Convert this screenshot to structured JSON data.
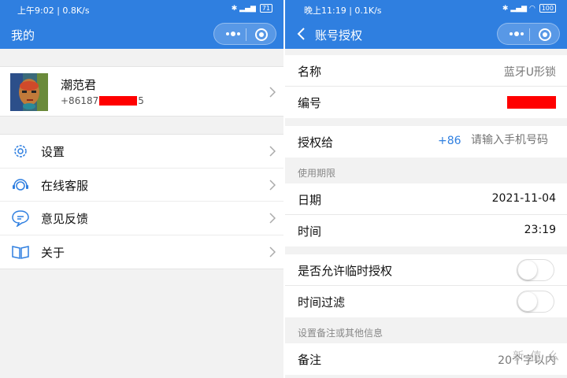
{
  "left": {
    "status": {
      "left": "上午9:02 | 0.8K/s",
      "right": "4G 4G 71"
    },
    "nav": {
      "title": "我的"
    },
    "profile": {
      "name": "潮范君",
      "phone_prefix": "+86187",
      "phone_suffix": "5"
    },
    "menu": [
      {
        "label": "设置",
        "icon": "gear-icon"
      },
      {
        "label": "在线客服",
        "icon": "headset-icon"
      },
      {
        "label": "意见反馈",
        "icon": "chat-icon"
      },
      {
        "label": "关于",
        "icon": "book-icon"
      }
    ]
  },
  "right": {
    "status": {
      "left": "晚上11:19 | 0.1K/s",
      "right": "100"
    },
    "nav": {
      "title": "账号授权"
    },
    "name_row": {
      "label": "名称",
      "value": "蓝牙U形锁"
    },
    "id_row": {
      "label": "编号"
    },
    "auth_row": {
      "label": "授权给",
      "country_code": "+86",
      "placeholder": "请输入手机号码"
    },
    "section_period": "使用期限",
    "date_row": {
      "label": "日期",
      "value": "2021-11-04"
    },
    "time_row": {
      "label": "时间",
      "value": "23:19"
    },
    "temp_auth": {
      "label": "是否允许临时授权",
      "on": false
    },
    "time_filter": {
      "label": "时间过滤",
      "on": false
    },
    "section_note": "设置备注或其他信息",
    "note_row": {
      "label": "备注",
      "value": "20个字以内"
    },
    "watermark": "新 值 么"
  },
  "colors": {
    "accent": "#2f7fe0",
    "redaction": "#ff0000",
    "background": "#f2f2f2"
  }
}
